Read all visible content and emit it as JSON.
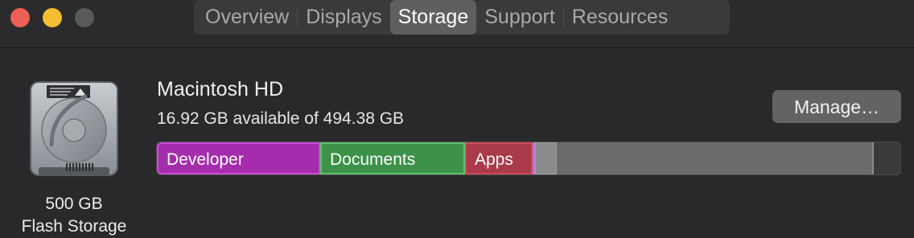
{
  "tabs": [
    {
      "label": "Overview",
      "active": false
    },
    {
      "label": "Displays",
      "active": false
    },
    {
      "label": "Storage",
      "active": true
    },
    {
      "label": "Support",
      "active": false
    },
    {
      "label": "Resources",
      "active": false
    }
  ],
  "drive": {
    "capacity": "500 GB",
    "type": "Flash Storage",
    "name": "Macintosh HD",
    "available": "16.92 GB available of 494.38 GB"
  },
  "manage_button": "Manage…",
  "storage_bar": {
    "segments": [
      {
        "label": "Developer",
        "color": "#a42cad"
      },
      {
        "label": "Documents",
        "color": "#3c9248"
      },
      {
        "label": "Apps",
        "color": "#a83a4a"
      }
    ]
  },
  "colors": {
    "close": "#ed5f57",
    "minimize": "#f5bd30",
    "zoom": "#5a5a5c"
  }
}
